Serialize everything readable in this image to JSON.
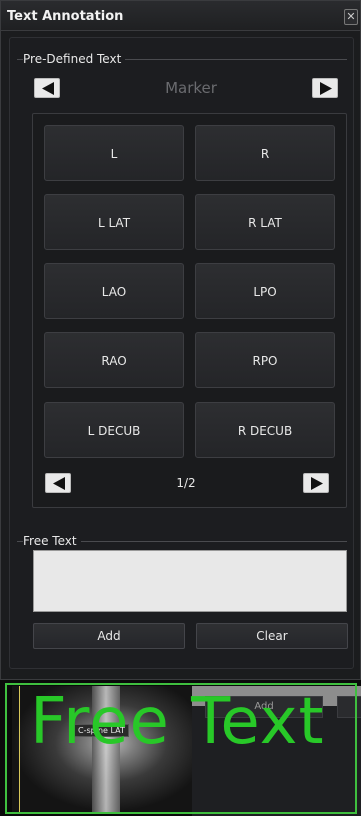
{
  "window": {
    "title": "Text Annotation",
    "close_glyph": "✕"
  },
  "predefined": {
    "section_label": "Pre-Defined Text",
    "category": "Marker",
    "buttons": [
      "L",
      "R",
      "L LAT",
      "R LAT",
      "LAO",
      "LPO",
      "RAO",
      "RPO",
      "L DECUB",
      "R DECUB"
    ],
    "page": "1/2"
  },
  "free_text": {
    "section_label": "Free Text",
    "value": "",
    "add_label": "Add",
    "clear_label": "Clear"
  },
  "preview": {
    "overlay_text": "Free Text",
    "image_tag": "C-spine LAT",
    "add_label": "Add",
    "overlay_color": "#28c828",
    "frame_color": "#3fbf3f"
  },
  "icons": {
    "prev": "triangle-left-icon",
    "next": "triangle-right-icon",
    "close": "close-icon"
  }
}
